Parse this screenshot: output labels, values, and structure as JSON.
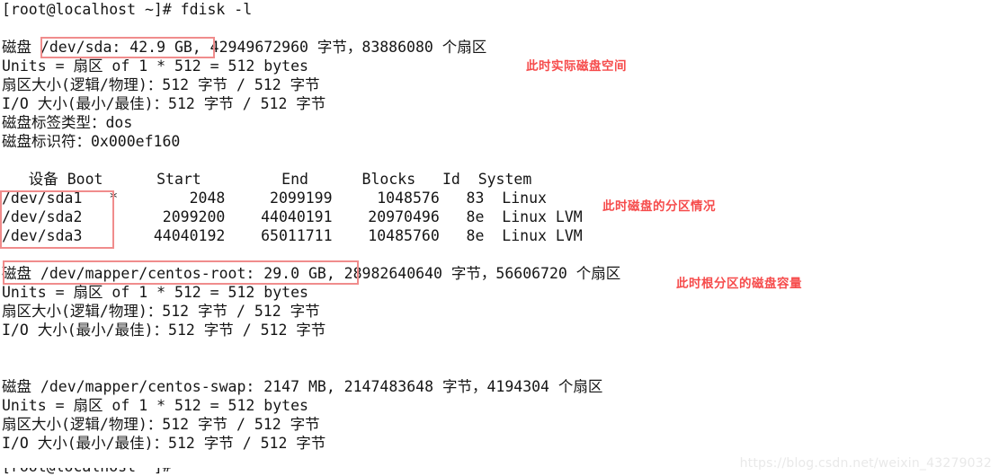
{
  "terminal": {
    "lines": [
      "[root@localhost ~]# fdisk -l",
      "",
      "磁盘 /dev/sda: 42.9 GB, 42949672960 字节，83886080 个扇区",
      "Units = 扇区 of 1 * 512 = 512 bytes",
      "扇区大小(逻辑/物理)：512 字节 / 512 字节",
      "I/O 大小(最小/最佳)：512 字节 / 512 字节",
      "磁盘标签类型：dos",
      "磁盘标识符：0x000ef160",
      "",
      "   设备 Boot      Start         End      Blocks   Id  System",
      "/dev/sda1   *        2048     2099199     1048576   83  Linux",
      "/dev/sda2         2099200    44040191    20970496   8e  Linux LVM",
      "/dev/sda3        44040192    65011711    10485760   8e  Linux LVM",
      "",
      "磁盘 /dev/mapper/centos-root: 29.0 GB, 28982640640 字节，56606720 个扇区",
      "Units = 扇区 of 1 * 512 = 512 bytes",
      "扇区大小(逻辑/物理)：512 字节 / 512 字节",
      "I/O 大小(最小/最佳)：512 字节 / 512 字节",
      "",
      "",
      "磁盘 /dev/mapper/centos-swap: 2147 MB, 2147483648 字节，4194304 个扇区",
      "Units = 扇区 of 1 * 512 = 512 bytes",
      "扇区大小(逻辑/物理)：512 字节 / 512 字节",
      "I/O 大小(最小/最佳)：512 字节 / 512 字节",
      ""
    ],
    "cutoff_line": "[root@localhost ~]# ",
    "prompt": "[root@localhost ~]#",
    "command": "fdisk -l"
  },
  "disks": [
    {
      "device": "/dev/sda",
      "size_label": "42.9 GB",
      "bytes": "42949672960",
      "sectors": "83886080",
      "units": "扇区 of 1 * 512 = 512 bytes",
      "sector_size": "512 字节 / 512 字节",
      "io_size": "512 字节 / 512 字节",
      "label_type": "dos",
      "identifier": "0x000ef160"
    },
    {
      "device": "/dev/mapper/centos-root",
      "size_label": "29.0 GB",
      "bytes": "28982640640",
      "sectors": "56606720",
      "units": "扇区 of 1 * 512 = 512 bytes",
      "sector_size": "512 字节 / 512 字节",
      "io_size": "512 字节 / 512 字节"
    },
    {
      "device": "/dev/mapper/centos-swap",
      "size_label": "2147 MB",
      "bytes": "2147483648",
      "sectors": "4194304",
      "units": "扇区 of 1 * 512 = 512 bytes",
      "sector_size": "512 字节 / 512 字节",
      "io_size": "512 字节 / 512 字节"
    }
  ],
  "partition_table": {
    "headers": [
      "设备",
      "Boot",
      "Start",
      "End",
      "Blocks",
      "Id",
      "System"
    ],
    "rows": [
      {
        "device": "/dev/sda1",
        "boot": "*",
        "start": "2048",
        "end": "2099199",
        "blocks": "1048576",
        "id": "83",
        "system": "Linux"
      },
      {
        "device": "/dev/sda2",
        "boot": "",
        "start": "2099200",
        "end": "44040191",
        "blocks": "20970496",
        "id": "8e",
        "system": "Linux LVM"
      },
      {
        "device": "/dev/sda3",
        "boot": "",
        "start": "44040192",
        "end": "65011711",
        "blocks": "10485760",
        "id": "8e",
        "system": "Linux LVM"
      }
    ]
  },
  "annotations": [
    {
      "id": "disk-space",
      "text": "此时实际磁盘空间"
    },
    {
      "id": "partitions",
      "text": "此时磁盘的分区情况"
    },
    {
      "id": "root-cap",
      "text": "此时根分区的磁盘容量"
    }
  ],
  "watermark": {
    "text": "https://blog.csdn.net/weixin_43279032"
  },
  "colors": {
    "text": "#151515",
    "annotation_red": "#f64b4b",
    "box_red": "#f08c8c",
    "background": "#ffffff",
    "watermark": "#e9e9e9"
  }
}
